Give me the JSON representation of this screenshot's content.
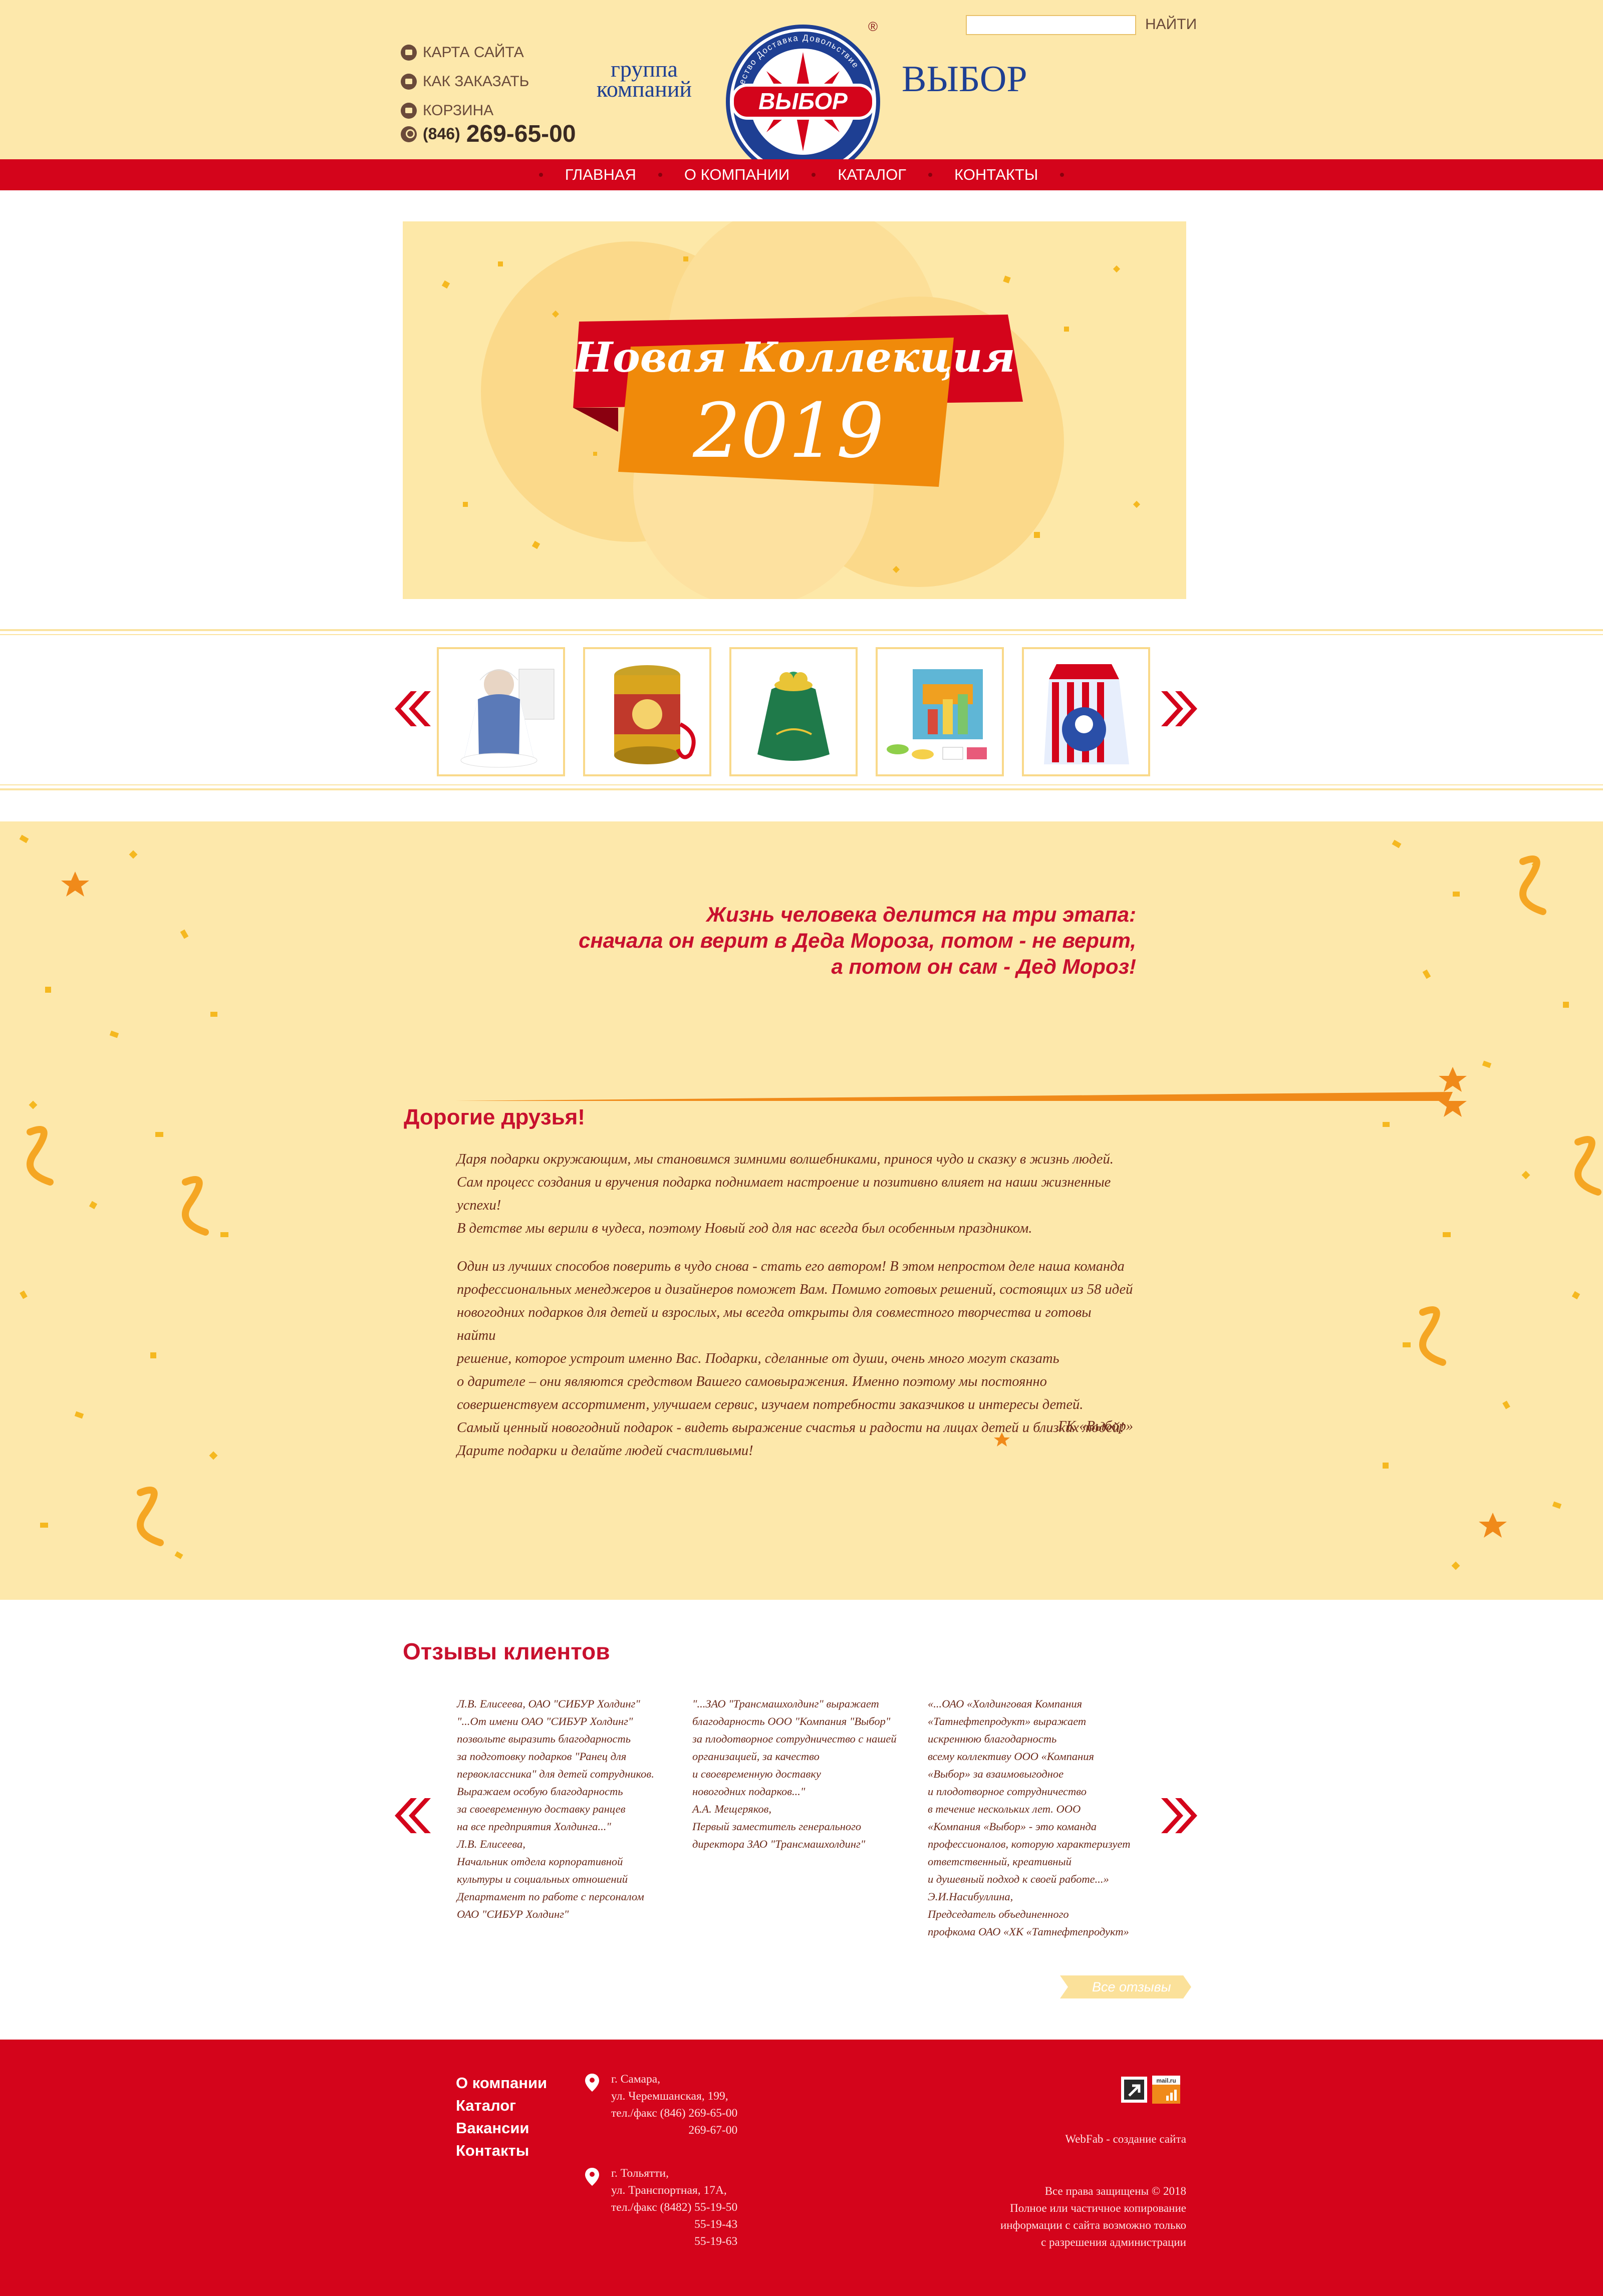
{
  "header": {
    "links": [
      "КАРТА САЙТА",
      "КАК ЗАКАЗАТЬ",
      "КОРЗИНА"
    ],
    "phone_code": "(846)",
    "phone_number": "269-65-00",
    "group_line1": "группа",
    "group_line2": "компаний",
    "brand": "ВЫБОР",
    "logo_text": "ВЫБОР",
    "logo_ring_text": "Качество Доставка Довольствие",
    "reg_mark": "®",
    "search_button": "НАЙТИ",
    "search_value": ""
  },
  "nav": {
    "items": [
      "ГЛАВНАЯ",
      "О КОМПАНИИ",
      "КАТАЛОГ",
      "КОНТАКТЫ"
    ]
  },
  "banner": {
    "title": "Новая Коллекция",
    "year": "2019"
  },
  "carousel": {
    "products": [
      "snow-maiden-doll",
      "tin-gift-can",
      "green-gift-bag",
      "startup-board-game",
      "gift-box"
    ]
  },
  "promo": {
    "quote_line1": "Жизнь человека делится на три этапа:",
    "quote_line2": "сначала он верит в Деда Мороза, потом - не верит,",
    "quote_line3": "а потом он сам - Дед Мороз!",
    "greeting": "Дорогие друзья!",
    "para1_lines": [
      "Даря подарки окружающим, мы становимся зимними волшебниками, принося чудо и сказку в жизнь людей.",
      "Сам процесс создания и вручения подарка поднимает настроение и позитивно влияет на наши жизненные успехи!",
      "В детстве мы верили в чудеса, поэтому Новый год для нас всегда был особенным праздником."
    ],
    "para2_lines": [
      "Один из лучших способов поверить в чудо снова - стать его автором! В этом непростом деле наша команда",
      "профессиональных менеджеров и дизайнеров поможет Вам. Помимо готовых решений, состоящих из 58 идей",
      "новогодних подарков для детей и взрослых, мы всегда открыты для совместного творчества и готовы найти",
      "решение, которое устроит именно Вас. Подарки, сделанные от души, очень много могут сказать",
      "о дарителе – они являются средством Вашего самовыражения. Именно поэтому мы постоянно",
      "совершенствуем ассортимент, улучшаем сервис, изучаем потребности заказчиков и интересы детей.",
      "Самый ценный новогодний подарок - видеть выражение счастья и радости на лицах детей и близких людей!",
      "Дарите подарки и делайте людей счастливыми!"
    ],
    "signature": "ГК «Выбор»"
  },
  "reviews": {
    "title": "Отзывы клиентов",
    "all_label": "Все отзывы",
    "items": [
      {
        "lines": [
          "Л.В. Елисеева, ОАО \"СИБУР Холдинг\"",
          "\"...От имени ОАО \"СИБУР Холдинг\"",
          "позвольте выразить благодарность",
          "за подготовку подарков \"Ранец для",
          "первоклассника\" для детей сотрудников.",
          "Выражаем особую благодарность",
          "за своевременную доставку ранцев",
          "на все предприятия Холдинга...\"",
          "Л.В. Елисеева,",
          "Начальник отдела корпоративной",
          "культуры и социальных отношений",
          "Департамент по работе с персоналом",
          "ОАО \"СИБУР Холдинг\""
        ]
      },
      {
        "lines": [
          "\"...ЗАО \"Трансмашхолдинг\" выражает",
          "благодарность ООО \"Компания \"Выбор\"",
          "за плодотворное сотрудничество с нашей",
          "организацией, за качество",
          "и своевременную доставку",
          "новогодних подарков...\"",
          "А.А. Мещеряков,",
          "Первый заместитель генерального",
          "директора ЗАО \"Трансмашхолдинг\""
        ]
      },
      {
        "lines": [
          "«...ОАО «Холдинговая Компания",
          "«Татнефтепродукт» выражает",
          "искреннюю благодарность",
          "всему коллективу ООО «Компания",
          "«Выбор» за взаимовыгодное",
          "и плодотворное сотрудничество",
          "в течение нескольких лет. ООО",
          "«Компания «Выбор» - это команда",
          "профессионалов, которую характеризует",
          "ответственный, креативный",
          "и душевный подход к своей работе...»",
          "Э.И.Насибуллина,",
          "Председатель объединенного",
          "профкома ОАО «ХК «Татнефтепродукт»"
        ]
      }
    ]
  },
  "footer": {
    "menu": [
      "О компании",
      "Каталог",
      "Вакансии",
      "Контакты"
    ],
    "samara_lines": [
      "г. Самара,",
      "ул. Черемшанская, 199,",
      "тел./факс (846) 269-65-00"
    ],
    "samara_extra": "269-67-00",
    "tolyatti_lines": [
      "г. Тольятти,",
      "ул. Транспортная, 17А,",
      "тел./факс (8482) 55-19-50"
    ],
    "tolyatti_extra": [
      "55-19-43",
      "55-19-63"
    ],
    "credit": "WebFab - создание сайта",
    "copyright_lines": [
      "Все права защищены © 2018",
      "Полное или частичное копирование",
      "информации с сайта возможно только",
      "с разрешения администрации"
    ],
    "counter_label": "mail.ru"
  },
  "colors": {
    "header_bg": "#fde8ab",
    "accent_red": "#d4041b",
    "brand_blue": "#1e3f93",
    "text_brown": "#6b2a1a"
  }
}
